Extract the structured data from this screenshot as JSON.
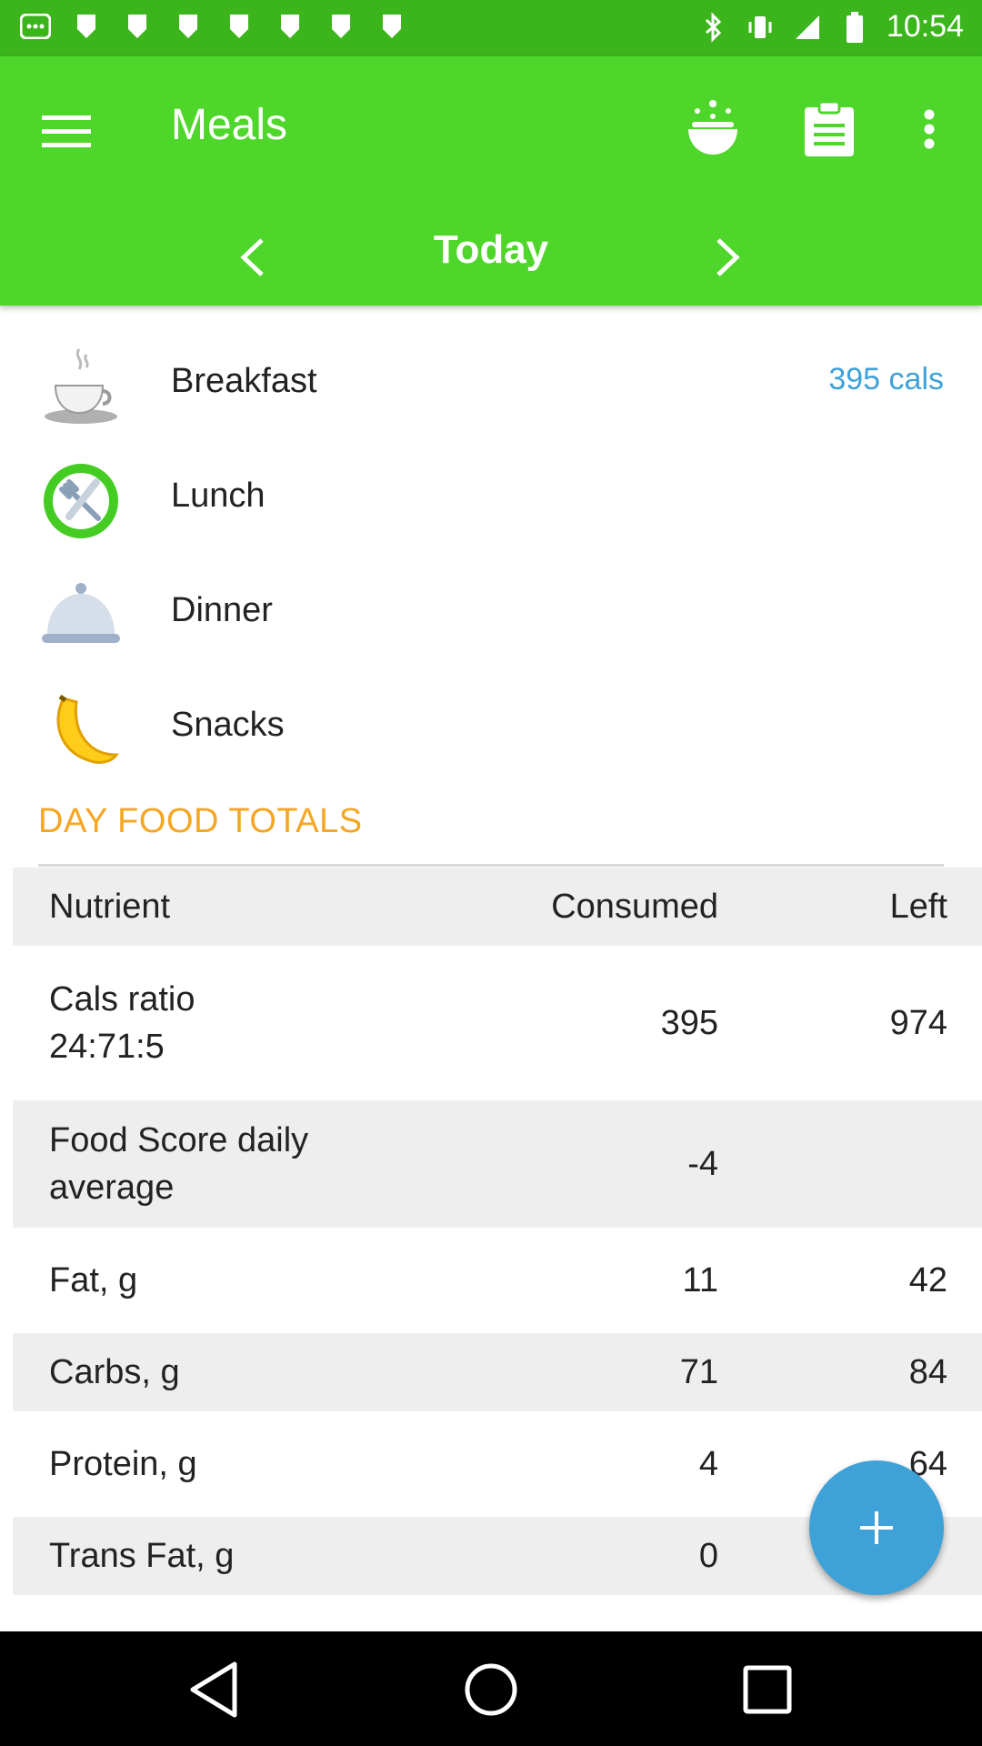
{
  "status_bar": {
    "time": "10:54"
  },
  "app_bar": {
    "title": "Meals",
    "date_label": "Today"
  },
  "meals": [
    {
      "label": "Breakfast",
      "cals": "395 cals",
      "icon": "coffee-cup-icon"
    },
    {
      "label": "Lunch",
      "cals": "",
      "icon": "fork-knife-icon"
    },
    {
      "label": "Dinner",
      "cals": "",
      "icon": "cloche-icon"
    },
    {
      "label": "Snacks",
      "cals": "",
      "icon": "banana-icon"
    }
  ],
  "totals": {
    "section_title": "DAY FOOD TOTALS",
    "header": {
      "nutrient": "Nutrient",
      "consumed": "Consumed",
      "left": "Left"
    },
    "rows": [
      {
        "nutrient": "Cals ratio\n24:71:5",
        "consumed": "395",
        "left": "974"
      },
      {
        "nutrient": "Food Score daily\naverage",
        "consumed": "-4",
        "left": ""
      },
      {
        "nutrient": "Fat, g",
        "consumed": "11",
        "left": "42"
      },
      {
        "nutrient": "Carbs, g",
        "consumed": "71",
        "left": "84"
      },
      {
        "nutrient": "Protein, g",
        "consumed": "4",
        "left": "64"
      },
      {
        "nutrient": "Trans Fat, g",
        "consumed": "0",
        "left": ""
      }
    ]
  },
  "colors": {
    "app_bar": "#4fd62a",
    "status_bar": "#3cb51c",
    "accent_blue": "#3ea1d8",
    "section_orange": "#f5a623"
  }
}
